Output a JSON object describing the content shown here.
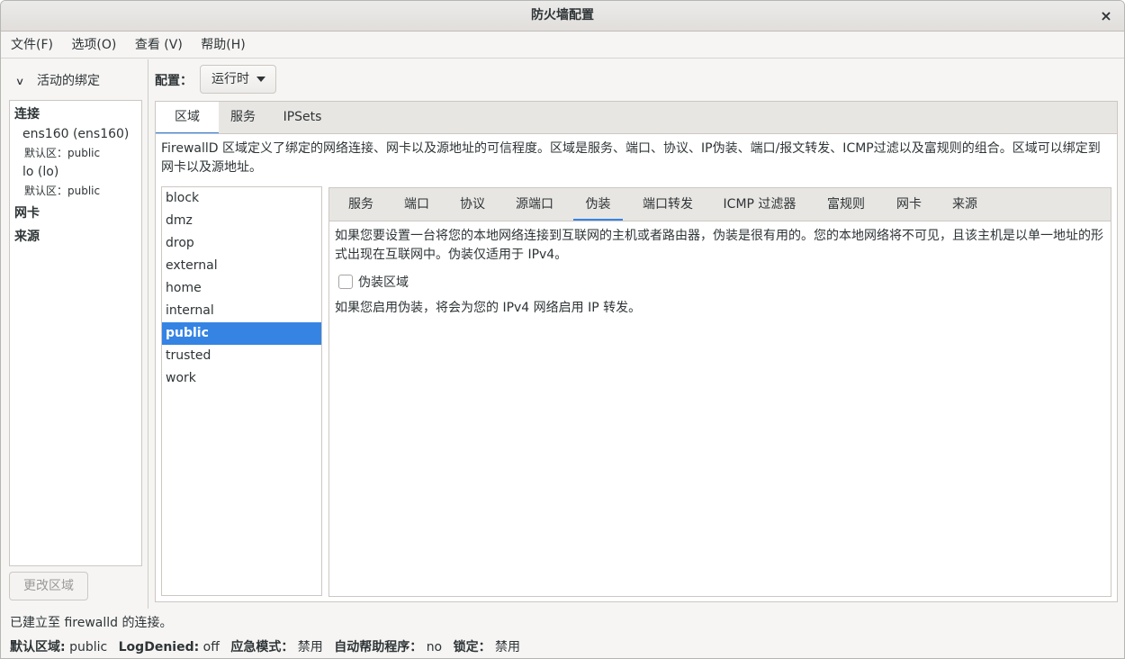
{
  "window": {
    "title": "防火墙配置",
    "close_glyph": "×"
  },
  "menu": [
    "文件(F)",
    "选项(O)",
    "查看 (V)",
    "帮助(H)"
  ],
  "left": {
    "expander_label": "活动的绑定",
    "sections": {
      "connections": "连接",
      "nic": "网卡",
      "sources": "来源"
    },
    "connections": [
      {
        "name": "ens160 (ens160)",
        "default_zone": "默认区：public"
      },
      {
        "name": "lo (lo)",
        "default_zone": "默认区：public"
      }
    ],
    "change_zone_button": "更改区域"
  },
  "config": {
    "label": "配置：",
    "value": "运行时"
  },
  "outer_tabs": [
    "区域",
    "服务",
    "IPSets"
  ],
  "outer_active": 0,
  "zone_description": "FirewallD 区域定义了绑定的网络连接、网卡以及源地址的可信程度。区域是服务、端口、协议、IP伪装、端口/报文转发、ICMP过滤以及富规则的组合。区域可以绑定到网卡以及源地址。",
  "zones": [
    "block",
    "dmz",
    "drop",
    "external",
    "home",
    "internal",
    "public",
    "trusted",
    "work"
  ],
  "selected_zone": "public",
  "inner_tabs": [
    "服务",
    "端口",
    "协议",
    "源端口",
    "伪装",
    "端口转发",
    "ICMP 过滤器",
    "富规则",
    "网卡",
    "来源"
  ],
  "inner_active": 4,
  "masquerade": {
    "description": "如果您要设置一台将您的本地网络连接到互联网的主机或者路由器，伪装是很有用的。您的本地网络将不可见，且该主机是以单一地址的形式出现在互联网中。伪装仅适用于 IPv4。",
    "checkbox_label": "伪装区域",
    "checked": false,
    "note": "如果您启用伪装，将会为您的 IPv4 网络启用 IP 转发。"
  },
  "status": {
    "connection": "已建立至 firewalld 的连接。",
    "default_zone_label": "默认区域:",
    "default_zone_value": "public",
    "logdenied_label": "LogDenied:",
    "logdenied_value": "off",
    "panic_label": "应急模式：",
    "panic_value": "禁用",
    "helpers_label": "自动帮助程序：",
    "helpers_value": "no",
    "lockdown_label": "锁定：",
    "lockdown_value": "禁用"
  },
  "colors": {
    "accent": "#3584e4",
    "window_bg": "#f6f5f4"
  }
}
